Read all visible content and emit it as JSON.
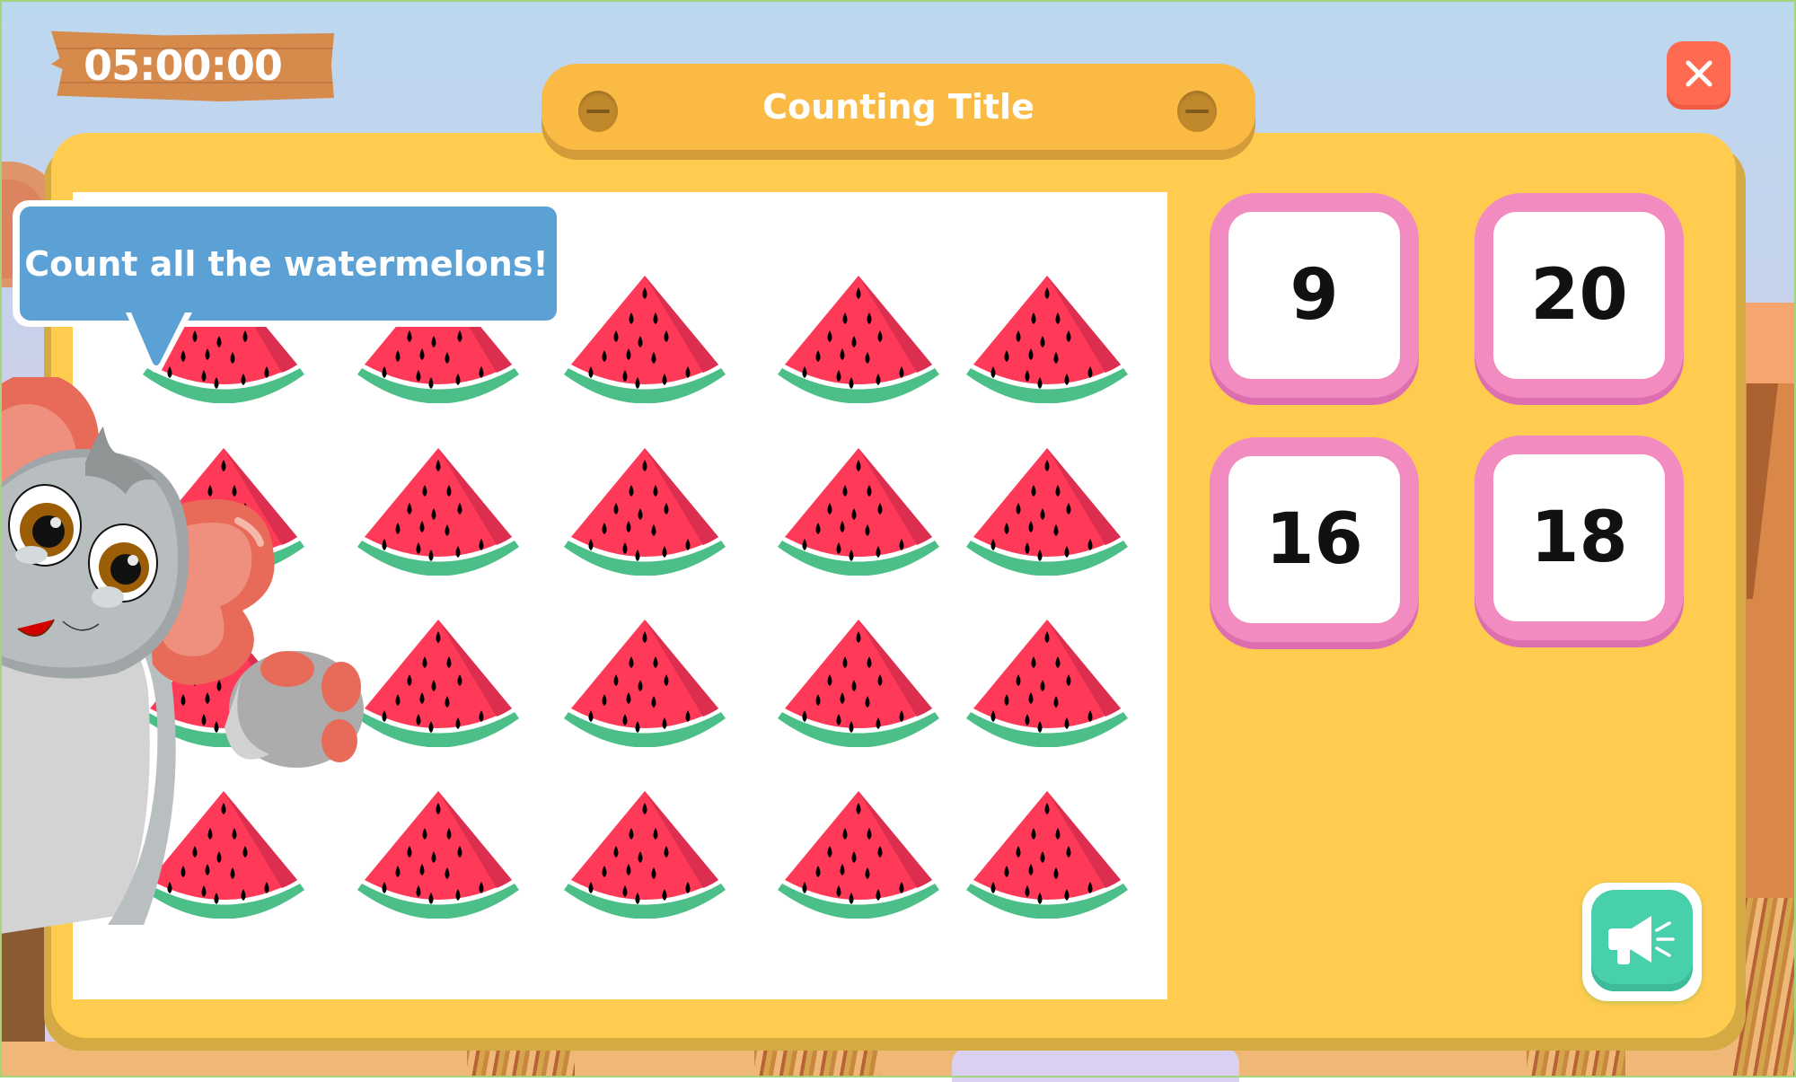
{
  "timer": {
    "value": "05:00:00",
    "icon": "wooden-sign"
  },
  "header": {
    "title": "Counting Title"
  },
  "close_button": {
    "icon": "close-icon",
    "label": "Close"
  },
  "prompt": {
    "text": "Count all the watermelons!"
  },
  "character": {
    "name": "elephant-mascot"
  },
  "counting_area": {
    "item": "watermelon",
    "rows": 4,
    "columns": 5,
    "count": 20
  },
  "answers": [
    {
      "label": "9"
    },
    {
      "label": "20"
    },
    {
      "label": "16"
    },
    {
      "label": "18"
    }
  ],
  "audio_button": {
    "icon": "megaphone-icon",
    "label": "Play instructions"
  },
  "colors": {
    "panel": "#ffcc50",
    "title_bar": "#fbba44",
    "answer_rim": "#f28bc0",
    "close": "#ff6b50",
    "audio": "#48cfab",
    "bubble": "#5ba1d5",
    "melon_flesh": "#ff3a58",
    "melon_rind": "#4cbf88"
  }
}
